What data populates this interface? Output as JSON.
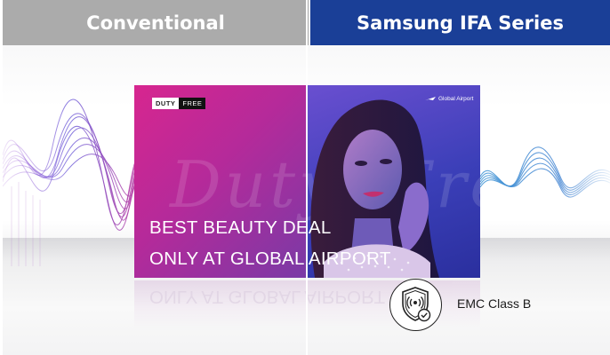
{
  "headers": {
    "left": "Conventional",
    "right": "Samsung IFA Series"
  },
  "poster": {
    "badge_duty": "DUTY",
    "badge_free": "FREE",
    "airport_logo": "Global Airport",
    "script_left": "Duty",
    "script_right": "Free",
    "headline_1": "BEST BEAUTY DEAL",
    "headline_2": "ONLY AT GLOBAL AIRPORT",
    "reflection_text": "ONLY AT GLOBAL AIRPORT"
  },
  "feature": {
    "icon": "shield-signal-check-icon",
    "label": "EMC Class B"
  },
  "colors": {
    "conventional_header": "#ababab",
    "samsung_header": "#1a3f97",
    "poster_magenta": "#d7268f",
    "poster_blue": "#3b3fb8"
  }
}
